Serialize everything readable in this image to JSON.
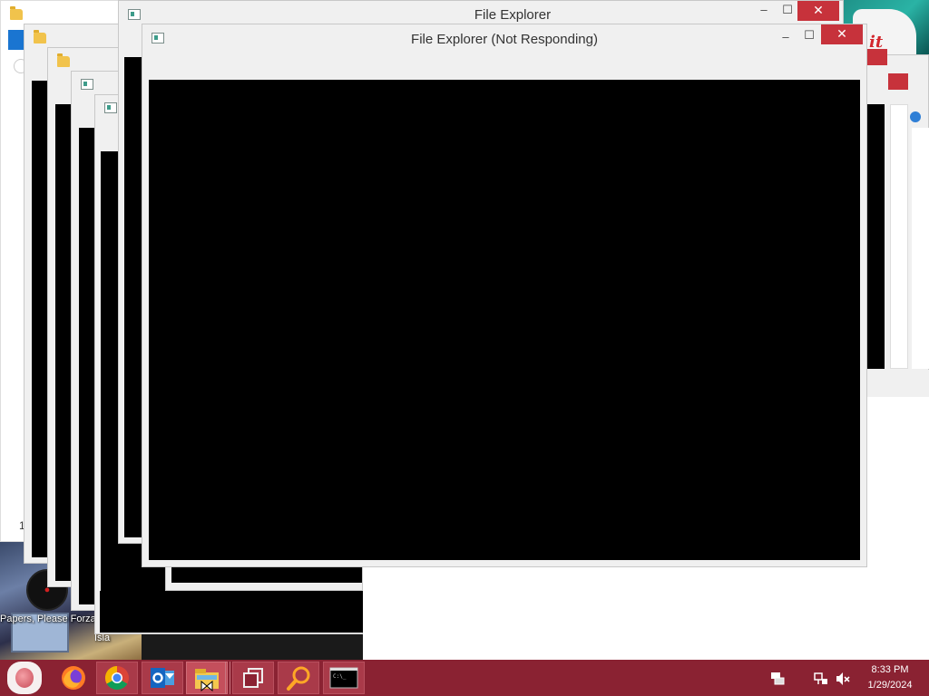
{
  "front_window": {
    "title": "File Explorer (Not Responding)",
    "controls": {
      "minimize": "–",
      "maximize": "☐",
      "close": "✕"
    }
  },
  "second_window": {
    "title": "File Explorer",
    "controls": {
      "minimize": "–",
      "maximize": "☐",
      "close": "✕"
    }
  },
  "desktop": {
    "icons": [
      {
        "label": "Papers, Please Forza"
      },
      {
        "label": "Isla"
      }
    ],
    "wallpaper_logo": "it"
  },
  "left_window_fragment_char": "1",
  "taskbar": {
    "items": [
      {
        "name": "Firefox",
        "icon": "firefox-icon"
      },
      {
        "name": "Chrome",
        "icon": "chrome-icon"
      },
      {
        "name": "Outlook",
        "icon": "outlook-icon"
      },
      {
        "name": "File Explorer",
        "icon": "folder-icon"
      },
      {
        "name": "Task View",
        "icon": "task-view-icon"
      },
      {
        "name": "Search",
        "icon": "search-icon"
      },
      {
        "name": "Command Prompt",
        "icon": "cmd-icon"
      }
    ],
    "clock": {
      "time": "8:33 PM",
      "date": "1/29/2024"
    }
  },
  "colors": {
    "taskbar": "#8a2232",
    "close_button": "#c7323b",
    "window_frame": "#f0f0f0"
  }
}
